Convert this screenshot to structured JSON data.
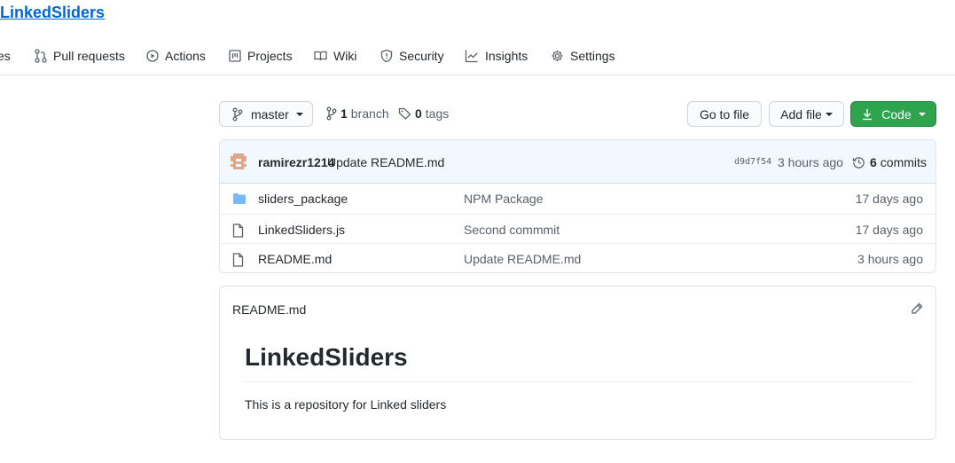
{
  "repo": {
    "name": "LinkedSliders"
  },
  "nav": {
    "items": [
      {
        "label": "es",
        "icon": "issue-opened-icon"
      },
      {
        "label": "Pull requests",
        "icon": "git-pull-request-icon"
      },
      {
        "label": "Actions",
        "icon": "play-icon"
      },
      {
        "label": "Projects",
        "icon": "project-icon"
      },
      {
        "label": "Wiki",
        "icon": "book-icon"
      },
      {
        "label": "Security",
        "icon": "shield-icon"
      },
      {
        "label": "Insights",
        "icon": "graph-icon"
      },
      {
        "label": "Settings",
        "icon": "gear-icon"
      }
    ]
  },
  "toolbar": {
    "branch": "master",
    "branches_count": "1",
    "branches_label": "branch",
    "tags_count": "0",
    "tags_label": "tags",
    "go_to_file": "Go to file",
    "add_file": "Add file",
    "code": "Code"
  },
  "commit": {
    "author": "ramirezr1214",
    "message": "Update README.md",
    "sha": "d9d7f54",
    "time": "3 hours ago",
    "count": "6",
    "count_label": "commits"
  },
  "files": [
    {
      "name": "sliders_package",
      "type": "folder",
      "message": "NPM Package",
      "age": "17 days ago"
    },
    {
      "name": "LinkedSliders.js",
      "type": "file",
      "message": "Second commmit",
      "age": "17 days ago"
    },
    {
      "name": "README.md",
      "type": "file",
      "message": "Update README.md",
      "age": "3 hours ago"
    }
  ],
  "readme": {
    "filename": "README.md",
    "heading": "LinkedSliders",
    "body": "This is a repository for Linked sliders"
  },
  "colors": {
    "link": "#0366d6",
    "primary_button": "#2ea44f",
    "commit_bar": "#f1f8ff",
    "folder": "#79b8ff",
    "avatar": "#e0a58a"
  }
}
